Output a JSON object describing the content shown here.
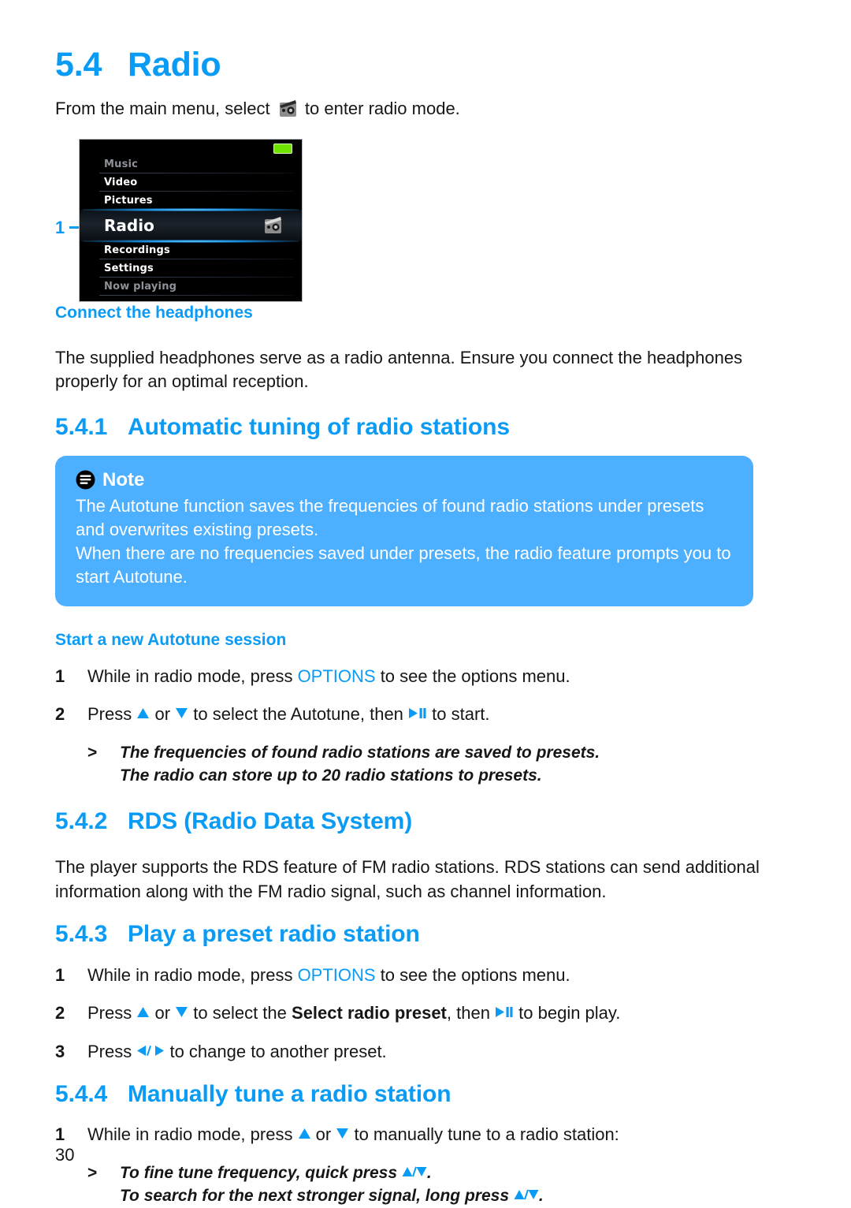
{
  "colors": {
    "heading_blue": "#0a9bf5",
    "note_bg": "#4dafff",
    "body_text": "#161616",
    "battery_green": "#6ee400"
  },
  "header": {
    "section_number": "5.4",
    "section_title": "Radio"
  },
  "intro": {
    "before_icon": "From the main menu, select ",
    "icon_name": "radio-icon",
    "after_icon": " to enter radio mode."
  },
  "device_screen": {
    "callout_label": "1",
    "items": [
      {
        "label": "Music",
        "state": "dim"
      },
      {
        "label": "Video",
        "state": "normal"
      },
      {
        "label": "Pictures",
        "state": "normal"
      },
      {
        "label": "Radio",
        "state": "selected"
      },
      {
        "label": "Recordings",
        "state": "normal"
      },
      {
        "label": "Settings",
        "state": "normal"
      },
      {
        "label": "Now playing",
        "state": "dim"
      }
    ],
    "battery_icon": "battery-full-icon"
  },
  "headphones": {
    "heading": "Connect the headphones",
    "body": "The supplied headphones serve as a radio antenna. Ensure you connect the headphones properly for an optimal reception."
  },
  "s541": {
    "number": "5.4.1",
    "title": "Automatic tuning of radio stations",
    "note": {
      "title": "Note",
      "icon": "note-icon",
      "paragraph_1": "The Autotune function saves the frequencies of found radio stations under presets and overwrites existing presets.",
      "paragraph_2": "When there are no frequencies saved under presets, the radio feature prompts you to start Autotune."
    },
    "subheading": "Start a new Autotune session",
    "steps": [
      {
        "n": "1",
        "parts": [
          {
            "t": "While in radio mode, press ",
            "style": "normal"
          },
          {
            "t": "OPTIONS",
            "style": "blue"
          },
          {
            "t": " to see the options menu.",
            "style": "normal"
          }
        ]
      },
      {
        "n": "2",
        "parts": [
          {
            "t": "Press ",
            "style": "normal"
          },
          {
            "t": "",
            "style": "icon-up"
          },
          {
            "t": " or ",
            "style": "normal"
          },
          {
            "t": "",
            "style": "icon-down"
          },
          {
            "t": " to select the Autotune, then ",
            "style": "normal"
          },
          {
            "t": "",
            "style": "icon-playpause"
          },
          {
            "t": " to start.",
            "style": "normal"
          }
        ]
      }
    ],
    "result_lines": [
      "The frequencies of found radio stations are saved to presets.",
      "The radio can store up to 20 radio stations to presets."
    ]
  },
  "s542": {
    "number": "5.4.2",
    "title": "RDS (Radio Data System)",
    "body": "The player supports the RDS feature of FM radio stations. RDS stations can send additional information along with the FM radio signal, such as channel information."
  },
  "s543": {
    "number": "5.4.3",
    "title": "Play a preset radio station",
    "steps": [
      {
        "n": "1",
        "parts": [
          {
            "t": "While in radio mode, press ",
            "style": "normal"
          },
          {
            "t": "OPTIONS",
            "style": "blue"
          },
          {
            "t": " to see the options menu.",
            "style": "normal"
          }
        ]
      },
      {
        "n": "2",
        "parts": [
          {
            "t": "Press ",
            "style": "normal"
          },
          {
            "t": "",
            "style": "icon-up"
          },
          {
            "t": " or ",
            "style": "normal"
          },
          {
            "t": "",
            "style": "icon-down"
          },
          {
            "t": " to select the ",
            "style": "normal"
          },
          {
            "t": "Select radio preset",
            "style": "bold"
          },
          {
            "t": ", then ",
            "style": "normal"
          },
          {
            "t": "",
            "style": "icon-playpause"
          },
          {
            "t": " to begin play.",
            "style": "normal"
          }
        ]
      },
      {
        "n": "3",
        "parts": [
          {
            "t": "Press ",
            "style": "normal"
          },
          {
            "t": "",
            "style": "icon-leftright"
          },
          {
            "t": " to change to another preset.",
            "style": "normal"
          }
        ]
      }
    ]
  },
  "s544": {
    "number": "5.4.4",
    "title": "Manually tune a radio station",
    "steps": [
      {
        "n": "1",
        "parts": [
          {
            "t": "While in radio mode, press ",
            "style": "normal"
          },
          {
            "t": "",
            "style": "icon-up"
          },
          {
            "t": " or ",
            "style": "normal"
          },
          {
            "t": "",
            "style": "icon-down"
          },
          {
            "t": " to manually tune to a radio station:",
            "style": "normal"
          }
        ]
      }
    ],
    "result_line_1_before": "To fine tune frequency, quick press ",
    "result_line_1_after": ".",
    "result_line_2_before": "To search for the next stronger signal, long press ",
    "result_line_2_after": "."
  },
  "footer": {
    "page_number": "30"
  }
}
